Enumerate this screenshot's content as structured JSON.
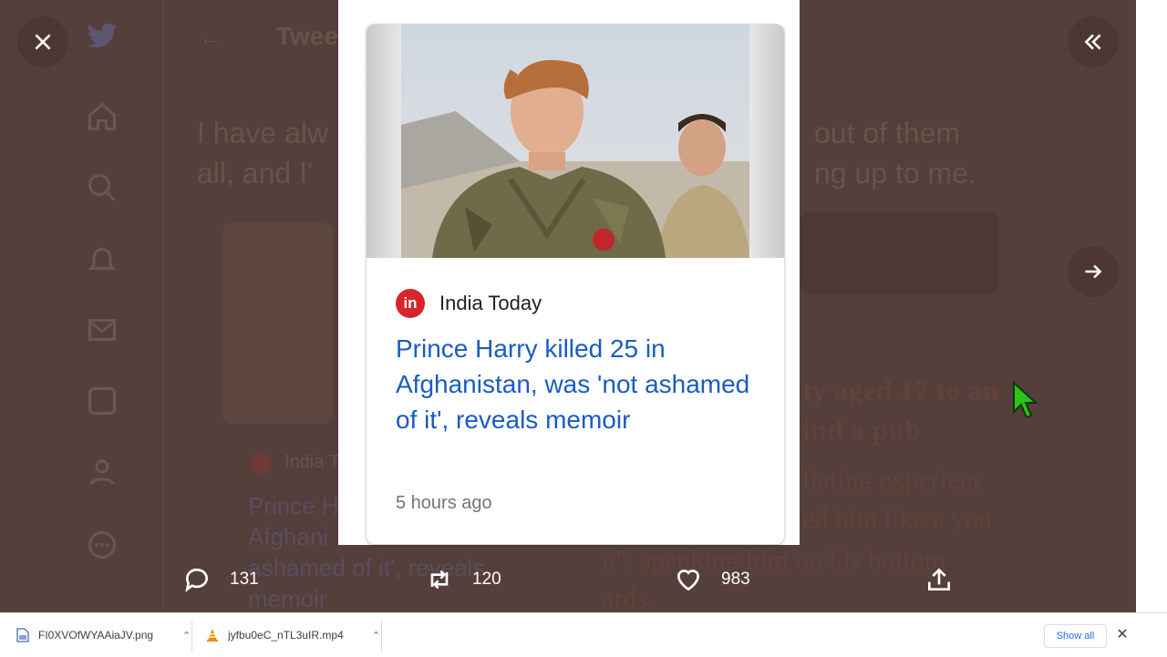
{
  "background_tweet": {
    "title_partial": "Twee",
    "text_left_1": "I have alw",
    "text_left_2": "all, and I'",
    "text_right_1": "out of them",
    "text_right_2": "ng up to me.",
    "embedded_source": "India To",
    "embedded_headline_1": "Prince H",
    "embedded_headline_2": "Afghani",
    "embedded_headline_3": "ashamed of it', reveals",
    "embedded_headline_4": "memoir",
    "right_serif_1": "ty aged 17 to an",
    "right_serif_2": "ind a pub",
    "right_serif_3": "liating experienc",
    "right_serif_4": "ed him like a you",
    "right_serif_5": "n\", spanking him on his bottom",
    "right_serif_6": "ards."
  },
  "card": {
    "source_name": "India Today",
    "source_logo_text": "in",
    "headline": "Prince Harry killed 25 in Afghanistan, was 'not ashamed of it', reveals memoir",
    "timestamp": "5 hours ago"
  },
  "actions": {
    "replies": "131",
    "retweets": "120",
    "likes": "983"
  },
  "downloads": {
    "items": [
      {
        "filename": "FI0XVOfWYAAiaJV.png",
        "icon": "image-file-icon"
      },
      {
        "filename": "jyfbu0eC_nTL3uIR.mp4",
        "icon": "vlc-cone-icon"
      }
    ],
    "show_all_label": "Show all"
  },
  "colors": {
    "backdrop": "#553f3a",
    "headline_link": "#1a5bc4",
    "source_logo": "#d6262b"
  }
}
